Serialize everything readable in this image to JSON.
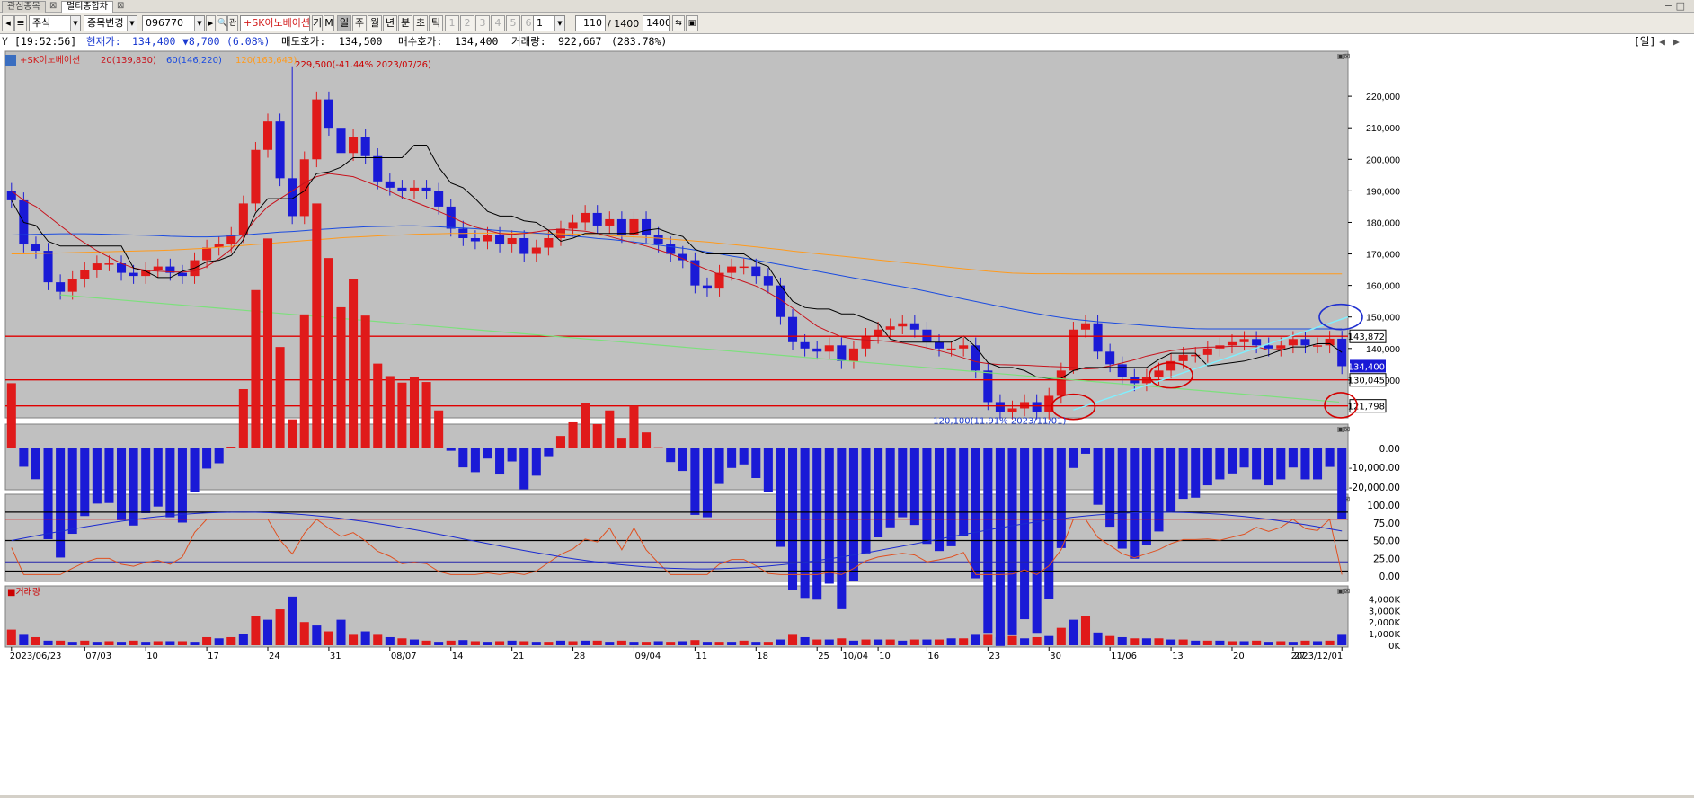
{
  "tabs": [
    {
      "label": "관심종목",
      "close": "⊠"
    },
    {
      "label": "멀티종합차",
      "close": "⊠"
    }
  ],
  "toolbar": {
    "market": "주식",
    "change_label": "종목변경",
    "code": "096770",
    "stock_name": "+SK이노베이션",
    "ki": "기",
    "m": "M",
    "periods": [
      "일",
      "주",
      "월",
      "년",
      "분",
      "초",
      "틱"
    ],
    "nums": [
      "1",
      "2",
      "3",
      "4",
      "5",
      "6"
    ],
    "num_sel": "1",
    "count": "110",
    "total": "/ 1400",
    "total2": "1400",
    "search_icon": "magnifier-icon",
    "bookmark_icon": "pin-icon"
  },
  "status": {
    "time": "[19:52:56]",
    "price_label": "현재가:",
    "price": "134,400",
    "change": "▼8,700",
    "change_pct": "(6.08%)",
    "ask_label": "매도호가:",
    "ask": "134,500",
    "bid_label": "매수호가:",
    "bid": "134,400",
    "vol_label": "거래량:",
    "vol": "922,667",
    "vol_pct": "(283.78%)",
    "period_badge": "[일]"
  },
  "legend": {
    "title": "+SK이노베이션",
    "ma20": "20(139,830)",
    "ma60": "60(146,220)",
    "ma120": "120(163,643)",
    "colors": {
      "title": "#d21b1b",
      "ma20": "#c8121c",
      "ma60": "#1a4be0",
      "ma120": "#ff9a1c"
    }
  },
  "annotations": {
    "high": "229,500(-41.44% 2023/07/26)",
    "low": "120,100(11.91% 2023/11/01)"
  },
  "price_axis": {
    "ticks": [
      "220,000",
      "210,000",
      "200,000",
      "190,000",
      "180,000",
      "170,000",
      "160,000",
      "150,000",
      "140,000",
      "130,000"
    ],
    "last": "134,400",
    "lines": [
      "143,872",
      "130,045",
      "121,798"
    ]
  },
  "macd_axis": [
    "0.00",
    "-10,000.00",
    "-20,000.00"
  ],
  "stoch_axis": [
    "100.00",
    "75.00",
    "50.00",
    "25.00",
    "0.00"
  ],
  "volume": {
    "label": "거래량",
    "ticks": [
      "4,000K",
      "3,000K",
      "2,000K",
      "1,000K",
      "0K"
    ]
  },
  "x_axis": [
    "2023/06/23",
    "07/03",
    "10",
    "17",
    "24",
    "31",
    "08/07",
    "14",
    "21",
    "28",
    "09/04",
    "11",
    "18",
    "25",
    "10/04",
    "10",
    "16",
    "23",
    "30",
    "11/06",
    "13",
    "20",
    "27",
    "2023/12/01"
  ],
  "colors": {
    "up": "#e01a1a",
    "down": "#1a1ad6",
    "bg": "#c0c0c0"
  },
  "chart_data": {
    "type": "candlestick",
    "dates": [
      "2023/06/23",
      "06/26",
      "06/27",
      "06/28",
      "06/29",
      "06/30",
      "07/03",
      "07/04",
      "07/05",
      "07/06",
      "07/07",
      "07/10",
      "07/11",
      "07/12",
      "07/13",
      "07/14",
      "07/17",
      "07/18",
      "07/19",
      "07/20",
      "07/21",
      "07/24",
      "07/25",
      "07/26",
      "07/27",
      "07/28",
      "07/31",
      "08/01",
      "08/02",
      "08/03",
      "08/04",
      "08/07",
      "08/08",
      "08/09",
      "08/10",
      "08/11",
      "08/14",
      "08/16",
      "08/17",
      "08/18",
      "08/21",
      "08/22",
      "08/23",
      "08/24",
      "08/25",
      "08/28",
      "08/29",
      "08/30",
      "08/31",
      "09/01",
      "09/04",
      "09/05",
      "09/06",
      "09/07",
      "09/08",
      "09/11",
      "09/12",
      "09/13",
      "09/14",
      "09/15",
      "09/18",
      "09/19",
      "09/20",
      "09/21",
      "09/22",
      "09/25",
      "09/26",
      "09/27",
      "10/04",
      "10/05",
      "10/06",
      "10/10",
      "10/11",
      "10/12",
      "10/13",
      "10/16",
      "10/17",
      "10/18",
      "10/19",
      "10/20",
      "10/23",
      "10/24",
      "10/25",
      "10/26",
      "10/27",
      "10/30",
      "10/31",
      "11/01",
      "11/02",
      "11/03",
      "11/06",
      "11/07",
      "11/08",
      "11/09",
      "11/10",
      "11/13",
      "11/14",
      "11/15",
      "11/16",
      "11/17",
      "11/20",
      "11/21",
      "11/22",
      "11/23",
      "11/24",
      "11/27",
      "11/28",
      "11/29",
      "11/30",
      "12/01"
    ],
    "close": [
      187000,
      173000,
      171000,
      161000,
      158000,
      162000,
      165000,
      167000,
      167000,
      164000,
      163000,
      165000,
      166000,
      164000,
      163000,
      168000,
      172000,
      173000,
      176000,
      186000,
      203000,
      212000,
      194000,
      182000,
      200000,
      219000,
      210000,
      202000,
      207000,
      201000,
      193000,
      191000,
      190000,
      191000,
      190000,
      185000,
      178000,
      175000,
      174000,
      176000,
      173000,
      175000,
      170000,
      172000,
      175000,
      178000,
      180000,
      183000,
      179000,
      181000,
      176000,
      181000,
      176000,
      173000,
      170000,
      168000,
      160000,
      159000,
      164000,
      166000,
      166000,
      163000,
      160000,
      150000,
      142000,
      140000,
      139000,
      141000,
      136000,
      140000,
      144000,
      146000,
      147000,
      148000,
      146000,
      142000,
      140000,
      140000,
      141000,
      133000,
      123000,
      120000,
      121000,
      123000,
      120000,
      125000,
      133000,
      146000,
      148000,
      139000,
      135000,
      131000,
      129000,
      131000,
      133000,
      136000,
      138000,
      138000,
      140000,
      141000,
      142000,
      143000,
      141000,
      140000,
      141000,
      143000,
      141000,
      141000,
      143100,
      134400
    ],
    "ma20": [
      190000,
      187000,
      185000,
      182000,
      179000,
      176000,
      173500,
      171000,
      169000,
      167000,
      165500,
      164800,
      164500,
      164300,
      164200,
      164600,
      166000,
      168500,
      171500,
      176000,
      181000,
      185000,
      187500,
      190000,
      192500,
      194500,
      195500,
      195000,
      194500,
      193000,
      191500,
      189800,
      188000,
      186500,
      185000,
      183500,
      181800,
      180000,
      178500,
      177500,
      176500,
      176200,
      176500,
      177000,
      177600,
      177800,
      177500,
      177200,
      176500,
      175500,
      174500,
      173500,
      172500,
      171300,
      170000,
      168500,
      166600,
      165000,
      163500,
      162500,
      161200,
      159800,
      157800,
      155500,
      152800,
      149900,
      147100,
      145300,
      143700,
      143000,
      142700,
      142500,
      142200,
      141700,
      141000,
      140200,
      139300,
      138300,
      137000,
      135800,
      135200,
      134900,
      134800,
      134700,
      134500,
      134300,
      134200,
      134000,
      133500,
      133700,
      134500,
      135400,
      136400,
      137600,
      138500,
      139300,
      139800,
      140200,
      140400,
      140500,
      140700,
      140700,
      140600,
      139500,
      139830
    ],
    "ma60": [
      176000,
      176100,
      176200,
      176300,
      176400,
      176400,
      176400,
      176300,
      176200,
      176100,
      176000,
      175900,
      175800,
      175600,
      175500,
      175400,
      175400,
      175500,
      175700,
      176000,
      176300,
      176600,
      176900,
      177100,
      177400,
      177700,
      177900,
      178200,
      178400,
      178600,
      178700,
      178800,
      178900,
      178900,
      178800,
      178600,
      178400,
      178200,
      178000,
      177700,
      177400,
      177200,
      176900,
      176600,
      176300,
      175900,
      175600,
      175300,
      174900,
      174600,
      174200,
      173800,
      173300,
      172800,
      172300,
      171800,
      171200,
      170600,
      170000,
      169300,
      168700,
      168000,
      167300,
      166600,
      165900,
      165200,
      164500,
      163800,
      163100,
      162400,
      161700,
      161000,
      160300,
      159600,
      158900,
      158100,
      157300,
      156500,
      155700,
      154900,
      154100,
      153300,
      152500,
      151800,
      151100,
      150400,
      149800,
      149300,
      148900,
      148500,
      148200,
      147900,
      147600,
      147300,
      147000,
      146700,
      146500,
      146300,
      146220,
      146220,
      146220,
      146220,
      146220,
      146220,
      146220,
      146220,
      146220,
      146220,
      146220,
      146220
    ],
    "ma120": [
      170000,
      170000,
      170100,
      170200,
      170300,
      170400,
      170500,
      170600,
      170700,
      170800,
      170900,
      171000,
      171100,
      171200,
      171400,
      171600,
      171800,
      172100,
      172400,
      172700,
      173000,
      173300,
      173600,
      173900,
      174200,
      174500,
      174800,
      175100,
      175300,
      175500,
      175700,
      175900,
      176000,
      176200,
      176300,
      176400,
      176500,
      176500,
      176600,
      176600,
      176600,
      176600,
      176600,
      176500,
      176500,
      176400,
      176300,
      176200,
      176000,
      175800,
      175600,
      175400,
      175200,
      175000,
      174700,
      174400,
      174100,
      173800,
      173400,
      173000,
      172600,
      172200,
      171800,
      171400,
      170900,
      170500,
      170100,
      169700,
      169300,
      168900,
      168500,
      168100,
      167700,
      167300,
      166900,
      166500,
      166100,
      165700,
      165300,
      164900,
      164500,
      164200,
      163900,
      163800,
      163700,
      163700,
      163700,
      163650,
      163643,
      163643,
      163643,
      163643,
      163643,
      163643,
      163643,
      163643,
      163643,
      163643,
      163643,
      163643,
      163643,
      163643,
      163643,
      163643,
      163643,
      163643,
      163643,
      163643,
      163643,
      163643
    ],
    "y_range": [
      120000,
      229500
    ],
    "high": 229500,
    "low": 120100,
    "levels": [
      143872,
      130045,
      121798
    ]
  }
}
